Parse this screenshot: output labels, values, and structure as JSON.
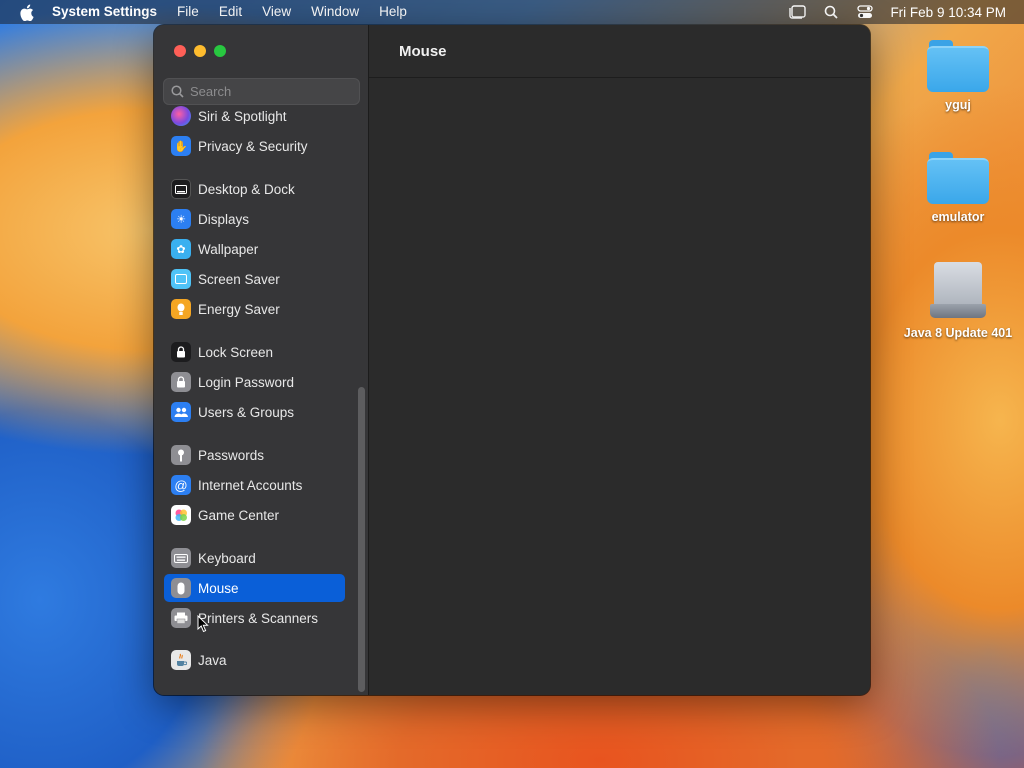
{
  "menubar": {
    "app_name": "System Settings",
    "items": [
      "File",
      "Edit",
      "View",
      "Window",
      "Help"
    ],
    "clock": "Fri Feb 9  10:34 PM"
  },
  "window": {
    "title": "Mouse",
    "search_placeholder": "Search",
    "sidebar_items": [
      {
        "label": "Siri & Spotlight",
        "icon": "siri-icon",
        "color": "#8e4ad6"
      },
      {
        "label": "Privacy & Security",
        "icon": "hand-icon",
        "color": "#2c7ff2"
      },
      {
        "label": "Desktop & Dock",
        "icon": "dock-icon",
        "color": "#1c1c1e"
      },
      {
        "label": "Displays",
        "icon": "sun-icon",
        "color": "#2c7ff2"
      },
      {
        "label": "Wallpaper",
        "icon": "flower-icon",
        "color": "#3ab0f0"
      },
      {
        "label": "Screen Saver",
        "icon": "screensaver-icon",
        "color": "#4fc3f7"
      },
      {
        "label": "Energy Saver",
        "icon": "bulb-icon",
        "color": "#f5a623"
      },
      {
        "label": "Lock Screen",
        "icon": "lock-icon",
        "color": "#1c1c1e"
      },
      {
        "label": "Login Password",
        "icon": "padlock-icon",
        "color": "#8e8e93"
      },
      {
        "label": "Users & Groups",
        "icon": "users-icon",
        "color": "#2c7ff2"
      },
      {
        "label": "Passwords",
        "icon": "key-icon",
        "color": "#8e8e93"
      },
      {
        "label": "Internet Accounts",
        "icon": "at-icon",
        "color": "#2c7ff2"
      },
      {
        "label": "Game Center",
        "icon": "gamecenter-icon",
        "color": "#ffffff"
      },
      {
        "label": "Keyboard",
        "icon": "keyboard-icon",
        "color": "#8e8e93"
      },
      {
        "label": "Mouse",
        "icon": "mouse-icon",
        "color": "#8e8e93"
      },
      {
        "label": "Printers & Scanners",
        "icon": "printer-icon",
        "color": "#8e8e93"
      },
      {
        "label": "Java",
        "icon": "java-icon",
        "color": "#e8e8e8"
      }
    ],
    "selected": "Mouse"
  },
  "desktop": {
    "icons": [
      {
        "label": "yguj",
        "type": "folder"
      },
      {
        "label": "emulator",
        "type": "folder"
      },
      {
        "label": "Java 8 Update 401",
        "type": "drive"
      }
    ]
  },
  "colors": {
    "accent": "#0a5fd8",
    "sidebar_bg": "#363638",
    "content_bg": "#2b2b2b"
  }
}
